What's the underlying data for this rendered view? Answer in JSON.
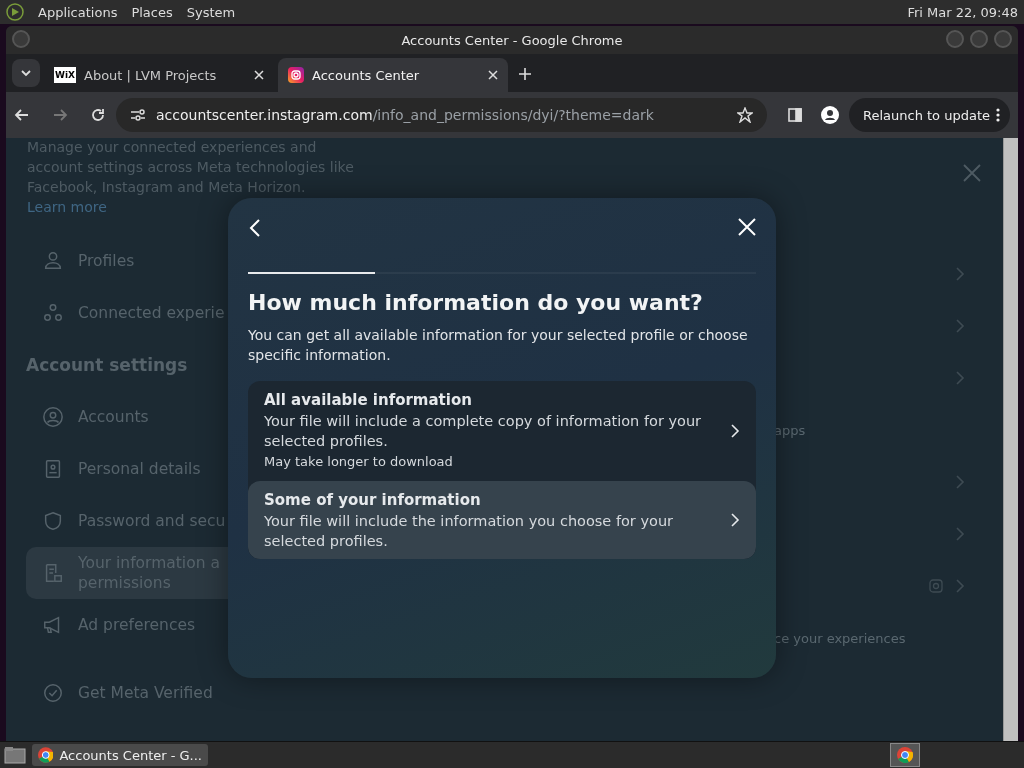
{
  "top_panel": {
    "menus": [
      "Applications",
      "Places",
      "System"
    ],
    "clock": "Fri Mar 22, 09:48"
  },
  "window": {
    "title": "Accounts Center - Google Chrome"
  },
  "tabs": [
    {
      "label": "About | LVM Projects",
      "kind": "wix",
      "favicon_text": "WiX",
      "selected": false
    },
    {
      "label": "Accounts Center",
      "kind": "instagram",
      "selected": true
    }
  ],
  "address_bar": {
    "host": "accountscenter.instagram.com",
    "path": "/info_and_permissions/dyi/?theme=dark"
  },
  "relaunch_button": "Relaunch to update",
  "page": {
    "intro": "Manage your connected experiences and account settings across Meta technologies like Facebook, Instagram and Meta Horizon.",
    "learn_more": "Learn more",
    "sidebar": [
      {
        "kind": "item",
        "label": "Profiles",
        "selected": false
      },
      {
        "kind": "item",
        "label": "Connected experie",
        "selected": false
      },
      {
        "kind": "header",
        "label": "Account settings"
      },
      {
        "kind": "item",
        "label": "Accounts",
        "selected": false
      },
      {
        "kind": "item",
        "label": "Personal details",
        "selected": false
      },
      {
        "kind": "item",
        "label": "Password and secu",
        "selected": false
      },
      {
        "kind": "item",
        "label": "Your information a\npermissions",
        "selected": true
      },
      {
        "kind": "item",
        "label": "Ad preferences",
        "selected": false
      },
      {
        "kind": "gap"
      },
      {
        "kind": "item",
        "label": "Get Meta Verified",
        "selected": false
      }
    ],
    "main_rows": [
      {
        "kind": "chevron"
      },
      {
        "kind": "chevron"
      },
      {
        "kind": "chevron"
      },
      {
        "kind": "text",
        "text": "apps"
      },
      {
        "kind": "chevron"
      },
      {
        "kind": "chevron"
      },
      {
        "kind": "chevron_instagram"
      },
      {
        "kind": "text",
        "text": "ce your experiences"
      }
    ]
  },
  "modal": {
    "progress": {
      "level": 0.25
    },
    "title": "How much information do you want?",
    "description": "You can get all available information for your selected profile or choose specific information.",
    "options": [
      {
        "title": "All available information",
        "description": "Your file will include a complete copy of information for your selected profiles.",
        "note": "May take longer to download",
        "highlighted": false
      },
      {
        "title": "Some of your information",
        "description": "Your file will include the information you choose for your selected profiles.",
        "highlighted": true
      }
    ]
  },
  "taskbar": {
    "window_button": "Accounts Center - G..."
  }
}
